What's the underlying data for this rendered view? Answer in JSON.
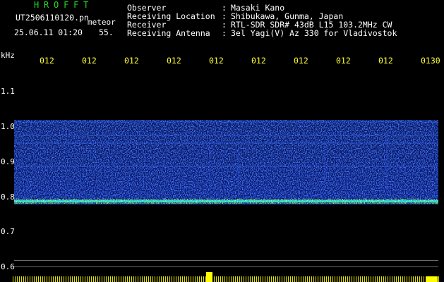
{
  "header": {
    "brand": "HROFFT",
    "filename": "UT2506110120.pn",
    "file_tag": "meteor",
    "date_time": "25.06.11 01:20",
    "number": "55."
  },
  "info": [
    {
      "label": "Observer",
      "value": "Masaki Kano"
    },
    {
      "label": "Receiving Location",
      "value": "Shibukawa, Gunma, Japan"
    },
    {
      "label": "Receiver",
      "value": "RTL-SDR SDR# 43dB L15 103.2MHz CW"
    },
    {
      "label": "Receiving Antenna",
      "value": "3el Yagi(V) Az 330 for Vladivostok"
    }
  ],
  "axis": {
    "unit": "kHz",
    "y_ticks": [
      "1.1",
      "1.0",
      "0.9",
      "0.8",
      "0.7",
      "0.6"
    ],
    "x_ticks": [
      "012",
      "012",
      "012",
      "012",
      "012",
      "012",
      "012",
      "012",
      "012",
      "0130"
    ]
  },
  "colors": {
    "brand": "#22dd22",
    "text": "#ffffff",
    "time_ticks": "#ffff33",
    "signal_noise": "#1a30d0",
    "signal_strong": "#00e0ff",
    "signal_peak": "#ffff00"
  }
}
